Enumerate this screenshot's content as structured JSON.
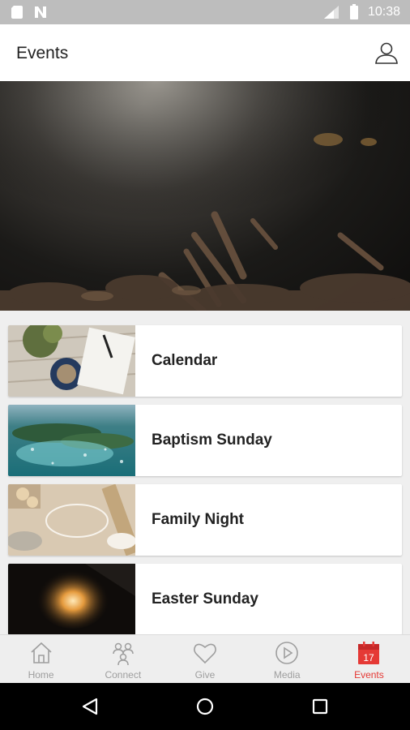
{
  "status_bar": {
    "time": "10:38"
  },
  "header": {
    "title": "Events"
  },
  "events": [
    {
      "label": "Calendar"
    },
    {
      "label": "Baptism Sunday"
    },
    {
      "label": "Family Night"
    },
    {
      "label": "Easter Sunday"
    }
  ],
  "tabs": [
    {
      "label": "Home",
      "icon": "home-icon"
    },
    {
      "label": "Connect",
      "icon": "connect-icon"
    },
    {
      "label": "Give",
      "icon": "heart-icon"
    },
    {
      "label": "Media",
      "icon": "play-icon"
    },
    {
      "label": "Events",
      "icon": "calendar-icon",
      "badge": "17",
      "active": true
    }
  ],
  "colors": {
    "accent": "#e53935",
    "inactive": "#9e9e9e",
    "status_bar": "#bdbdbd"
  }
}
